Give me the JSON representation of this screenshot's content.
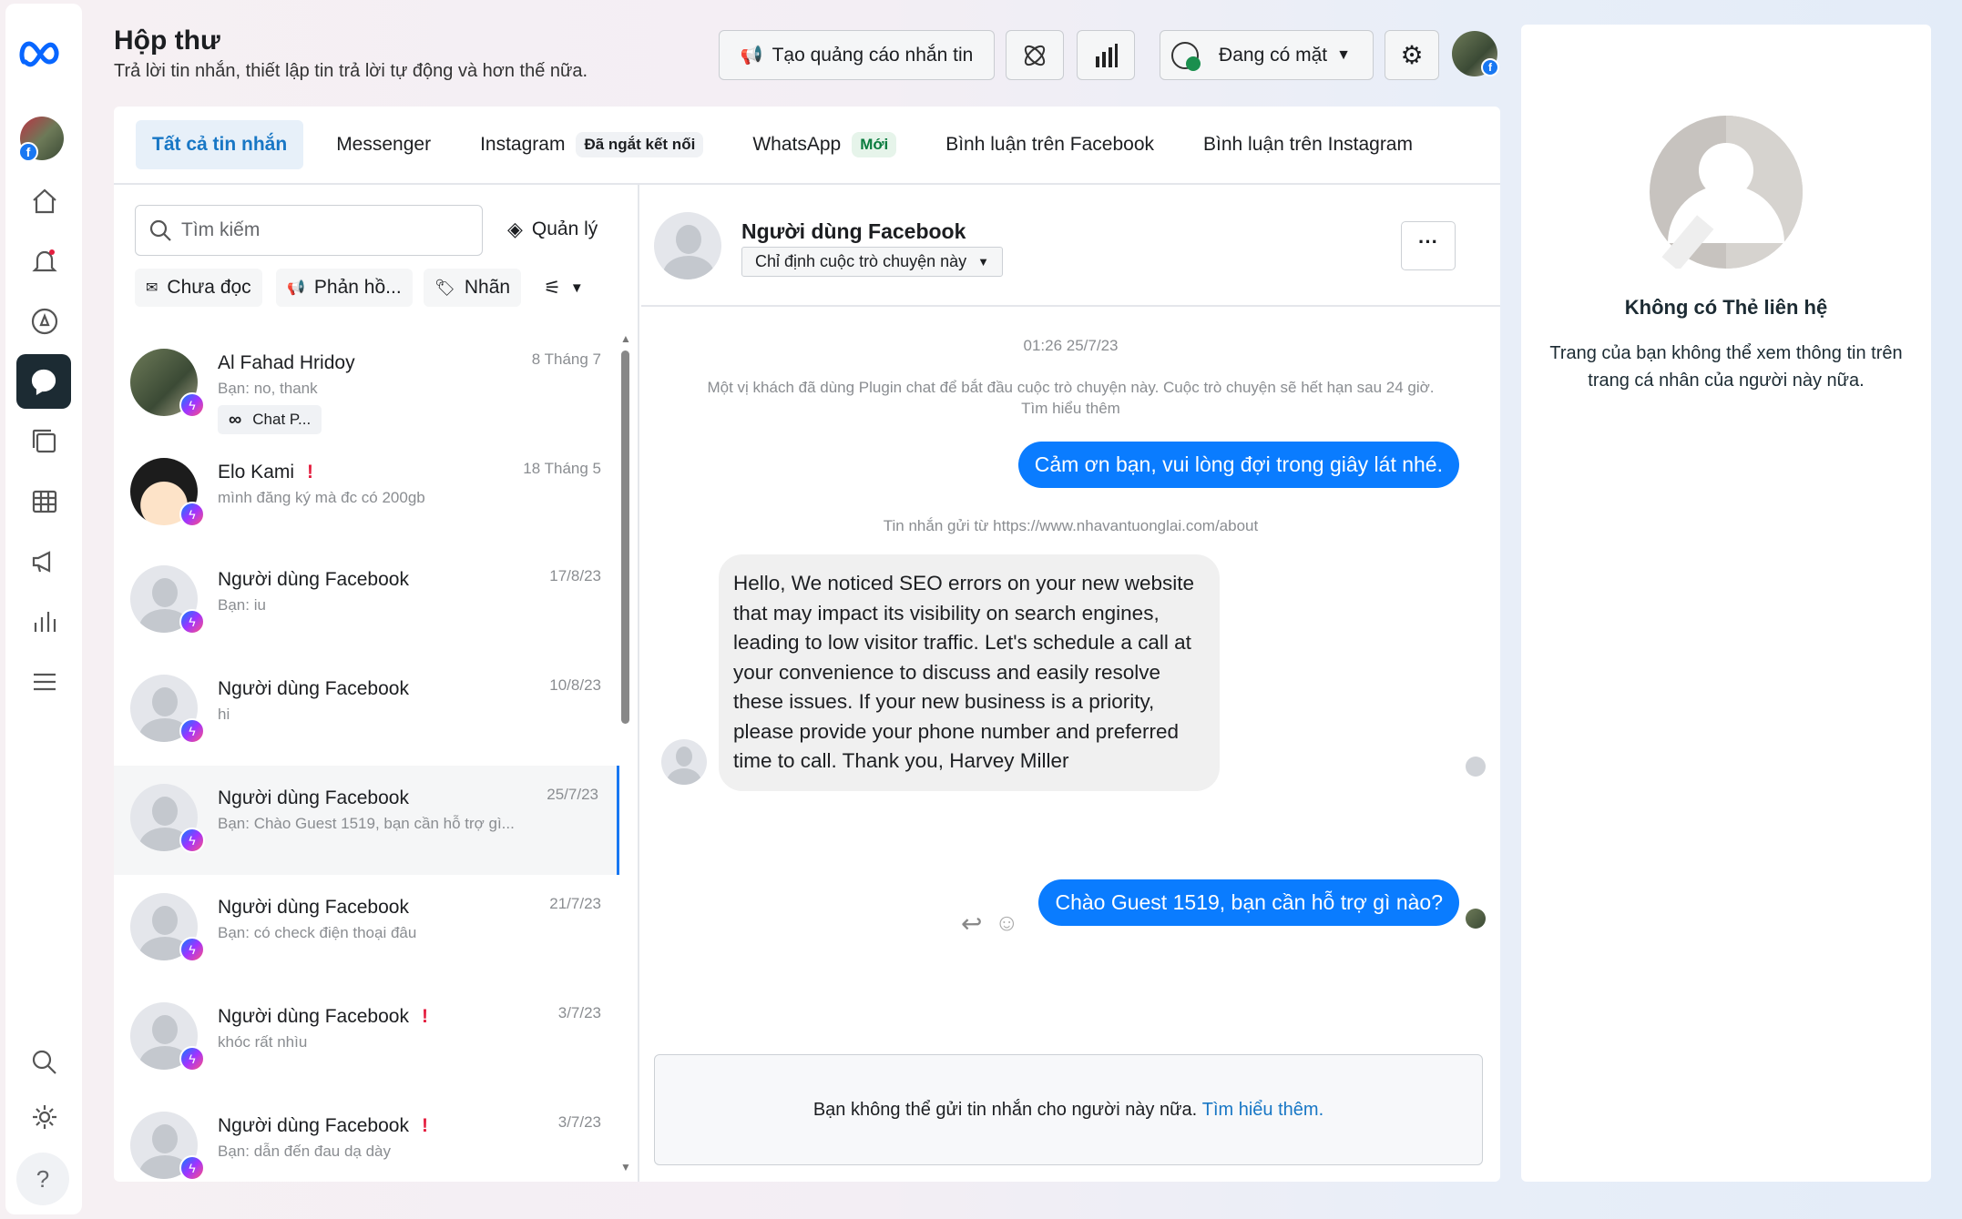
{
  "colors": {
    "accent": "#1877f2",
    "bubble_out": "#0a7cff",
    "status_online": "#1a8f4e",
    "warn": "#e41e3f"
  },
  "sidebar": {
    "items": [
      {
        "icon": "home-icon"
      },
      {
        "icon": "bell-icon"
      },
      {
        "icon": "compass-icon"
      },
      {
        "icon": "inbox-icon",
        "active": true
      },
      {
        "icon": "content-icon"
      },
      {
        "icon": "table-icon"
      },
      {
        "icon": "megaphone-icon"
      },
      {
        "icon": "bar-chart-icon"
      },
      {
        "icon": "menu-icon"
      },
      {
        "icon": "search-icon"
      },
      {
        "icon": "gear-icon"
      }
    ],
    "help": "?"
  },
  "header": {
    "title": "Hộp thư",
    "subtitle": "Trả lời tin nhắn, thiết lập tin trả lời tự động và hơn thế nữa.",
    "create_ad": "Tạo quảng cáo nhắn tin",
    "status": "Đang có mặt"
  },
  "tabs": [
    {
      "label": "Tất cả tin nhắn",
      "active": true
    },
    {
      "label": "Messenger"
    },
    {
      "label": "Instagram",
      "badge": "Đã ngắt kết nối"
    },
    {
      "label": "WhatsApp",
      "badge": "Mới"
    },
    {
      "label": "Bình luận trên Facebook"
    },
    {
      "label": "Bình luận trên Instagram"
    }
  ],
  "list": {
    "search_placeholder": "Tìm kiếm",
    "manage": "Quản lý",
    "filters": [
      "Chưa đọc",
      "Phản hồ...",
      "Nhãn"
    ],
    "items": [
      {
        "name": "Al Fahad Hridoy",
        "preview": "Bạn: no, thank",
        "date": "8 Tháng 7",
        "tag": "Chat P...",
        "avatar": "photo"
      },
      {
        "name": "Elo Kami",
        "preview": "mình đăng ký mà đc có 200gb",
        "date": "18 Tháng 5",
        "warn": true,
        "avatar": "cartoon"
      },
      {
        "name": "Người dùng Facebook",
        "preview": "Bạn: iu",
        "date": "17/8/23"
      },
      {
        "name": "Người dùng Facebook",
        "preview": "hi",
        "date": "10/8/23"
      },
      {
        "name": "Người dùng Facebook",
        "preview": "Bạn: Chào Guest 1519, bạn cần hỗ trợ gì...",
        "date": "25/7/23",
        "selected": true
      },
      {
        "name": "Người dùng Facebook",
        "preview": "Bạn: có check điện thoại đâu",
        "date": "21/7/23"
      },
      {
        "name": "Người dùng Facebook",
        "preview": "khóc rất nhìu",
        "date": "3/7/23",
        "warn": true
      },
      {
        "name": "Người dùng Facebook",
        "preview": "Bạn: dẫn đến đau dạ dày",
        "date": "3/7/23",
        "warn": true
      }
    ]
  },
  "chat": {
    "name": "Người dùng Facebook",
    "assign": "Chỉ định cuộc trò chuyện này",
    "timestamp": "01:26 25/7/23",
    "system_note": "Một vị khách đã dùng Plugin chat để bắt đầu cuộc trò chuyện này. Cuộc trò chuyện sẽ hết hạn sau 24 giờ.",
    "learn_more": "Tìm hiểu thêm",
    "msg1": "Cảm ơn bạn, vui lòng đợi trong giây lát nhé.",
    "source": "Tin nhắn gửi từ https://www.nhavantuonglai.com/about",
    "msg2": "Hello,  We noticed SEO errors on your new website that may impact its visibility on search engines, leading to low visitor traffic. Let's schedule a call at your convenience to discuss and easily resolve these issues. If your new business is a priority, please provide your phone number and preferred time to call.  Thank you, Harvey Miller",
    "msg3": "Chào Guest 1519, bạn cần hỗ trợ gì nào?",
    "composer_note": "Bạn không thể gửi tin nhắn cho người này nữa.",
    "composer_link": "Tìm hiểu thêm."
  },
  "contact": {
    "title": "Không có Thẻ liên hệ",
    "text": "Trang của bạn không thể xem thông tin trên trang cá nhân của người này nữa."
  }
}
